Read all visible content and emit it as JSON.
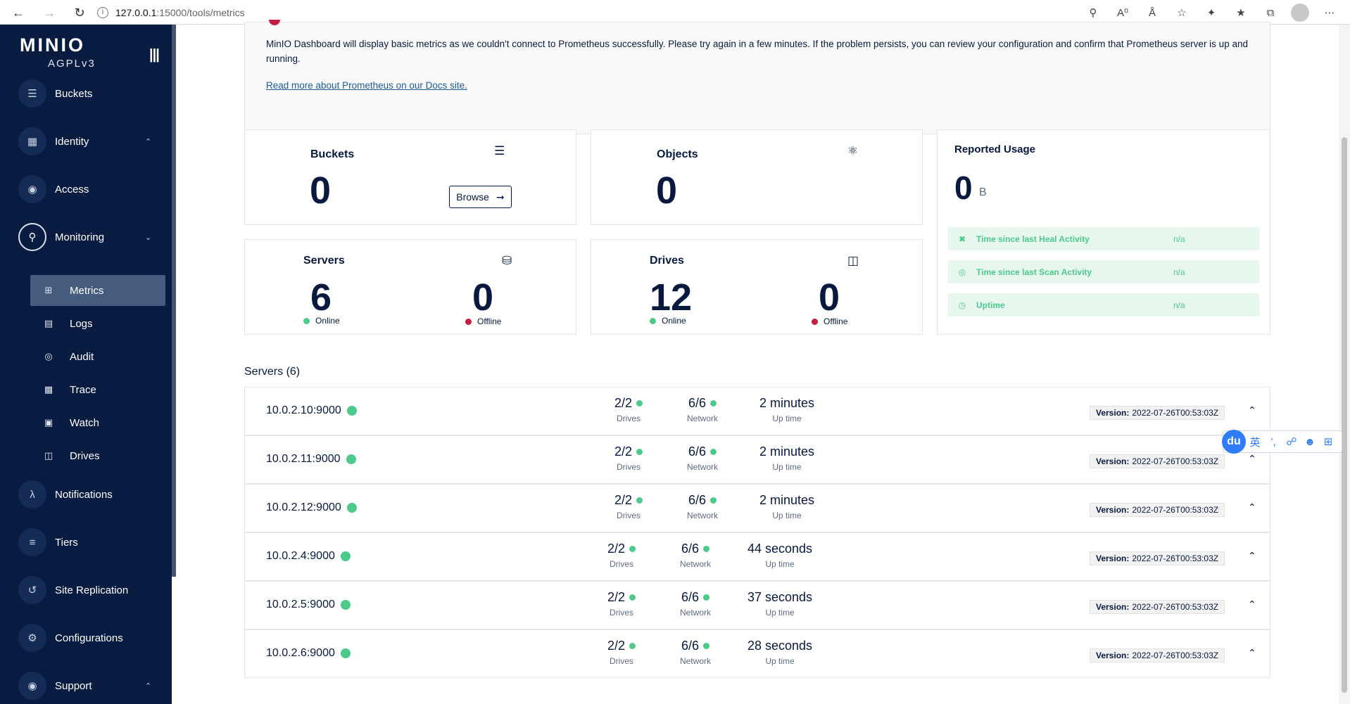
{
  "browser": {
    "url_host": "127.0.0.1",
    "url_path": ":15000/tools/metrics"
  },
  "sidebar": {
    "logo": "MINIO",
    "license": "AGPLv3",
    "items": [
      {
        "label": "Buckets"
      },
      {
        "label": "Identity"
      },
      {
        "label": "Access"
      },
      {
        "label": "Monitoring"
      },
      {
        "label": "Notifications"
      },
      {
        "label": "Tiers"
      },
      {
        "label": "Site Replication"
      },
      {
        "label": "Configurations"
      },
      {
        "label": "Support"
      }
    ],
    "monitoring_sub": [
      {
        "label": "Metrics"
      },
      {
        "label": "Logs"
      },
      {
        "label": "Audit"
      },
      {
        "label": "Trace"
      },
      {
        "label": "Watch"
      },
      {
        "label": "Drives"
      }
    ]
  },
  "alert": {
    "message": "MinIO Dashboard will display basic metrics as we couldn't connect to Prometheus successfully. Please try again in a few minutes. If the problem persists, you can review your configuration and confirm that Prometheus server is up and running.",
    "link": "Read more about Prometheus on our Docs site."
  },
  "cards": {
    "buckets": {
      "label": "Buckets",
      "value": "0",
      "button": "Browse"
    },
    "objects": {
      "label": "Objects",
      "value": "0"
    },
    "usage": {
      "label": "Reported Usage",
      "value": "0",
      "unit": "B",
      "rows": [
        {
          "label": "Time since last Heal Activity",
          "value": "n/a"
        },
        {
          "label": "Time since last Scan Activity",
          "value": "n/a"
        },
        {
          "label": "Uptime",
          "value": "n/a"
        }
      ]
    },
    "servers": {
      "label": "Servers",
      "online": "6",
      "offline": "0",
      "online_label": "Online",
      "offline_label": "Offline"
    },
    "drives": {
      "label": "Drives",
      "online": "12",
      "offline": "0",
      "online_label": "Online",
      "offline_label": "Offline"
    }
  },
  "servers_section": {
    "title": "Servers (6)",
    "drives_label": "Drives",
    "network_label": "Network",
    "uptime_label": "Up time",
    "version_label": "Version:",
    "rows": [
      {
        "host": "10.0.2.10:9000",
        "drives": "2/2",
        "network": "6/6",
        "uptime": "2 minutes",
        "version": "2022-07-26T00:53:03Z"
      },
      {
        "host": "10.0.2.11:9000",
        "drives": "2/2",
        "network": "6/6",
        "uptime": "2 minutes",
        "version": "2022-07-26T00:53:03Z"
      },
      {
        "host": "10.0.2.12:9000",
        "drives": "2/2",
        "network": "6/6",
        "uptime": "2 minutes",
        "version": "2022-07-26T00:53:03Z"
      },
      {
        "host": "10.0.2.4:9000",
        "drives": "2/2",
        "network": "6/6",
        "uptime": "44 seconds",
        "version": "2022-07-26T00:53:03Z"
      },
      {
        "host": "10.0.2.5:9000",
        "drives": "2/2",
        "network": "6/6",
        "uptime": "37 seconds",
        "version": "2022-07-26T00:53:03Z"
      },
      {
        "host": "10.0.2.6:9000",
        "drives": "2/2",
        "network": "6/6",
        "uptime": "28 seconds",
        "version": "2022-07-26T00:53:03Z"
      }
    ]
  },
  "ime": {
    "logo": "du",
    "lang": "英"
  },
  "colors": {
    "sidebar_bg": "#081c42",
    "accent_green": "#4cca8a",
    "accent_red": "#c51d3f",
    "text_dark": "#07193e"
  }
}
